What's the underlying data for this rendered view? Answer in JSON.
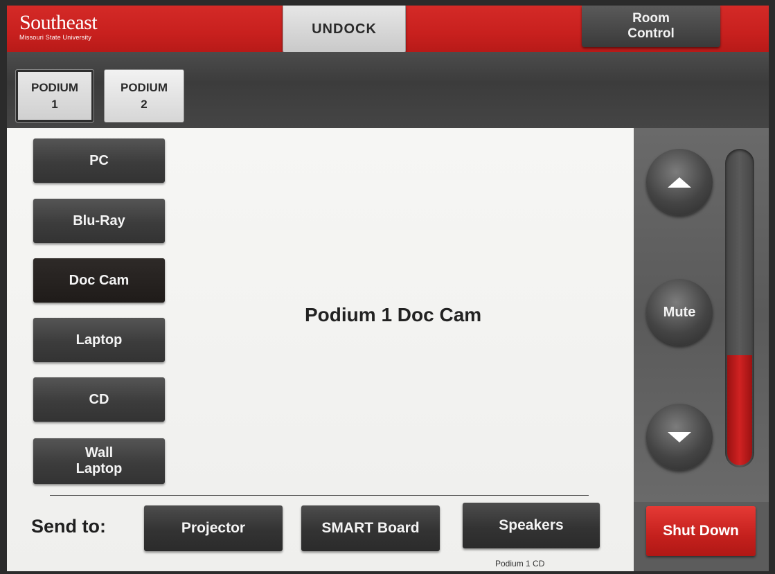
{
  "header": {
    "logo_brand": "Southeast",
    "logo_sub": "Missouri State University",
    "undock_label": "UNDOCK",
    "room_control_line1": "Room",
    "room_control_line2": "Control",
    "accent_color": "#c8201e"
  },
  "podium_tabs": [
    {
      "line1": "PODIUM",
      "line2": "1",
      "selected": true
    },
    {
      "line1": "PODIUM",
      "line2": "2",
      "selected": false
    }
  ],
  "sources": [
    {
      "label": "PC",
      "selected": false
    },
    {
      "label": "Blu-Ray",
      "selected": false
    },
    {
      "label": "Doc Cam",
      "selected": true
    },
    {
      "label": "Laptop",
      "selected": false
    },
    {
      "label": "CD",
      "selected": false
    },
    {
      "label_line1": "Wall",
      "label_line2": "Laptop",
      "selected": false
    }
  ],
  "display": {
    "current_source": "Podium 1 Doc Cam"
  },
  "send_to": {
    "label": "Send to:",
    "destinations": [
      {
        "label": "Projector"
      },
      {
        "label": "SMART Board"
      },
      {
        "label": "Speakers",
        "sub": "Podium 1 CD"
      }
    ]
  },
  "volume": {
    "up_icon": "triangle-up-icon",
    "mute_label": "Mute",
    "down_icon": "triangle-down-icon",
    "level_fraction": 0.35,
    "fill_color": "#d02222"
  },
  "shutdown": {
    "label": "Shut Down",
    "color": "#d42a27"
  }
}
